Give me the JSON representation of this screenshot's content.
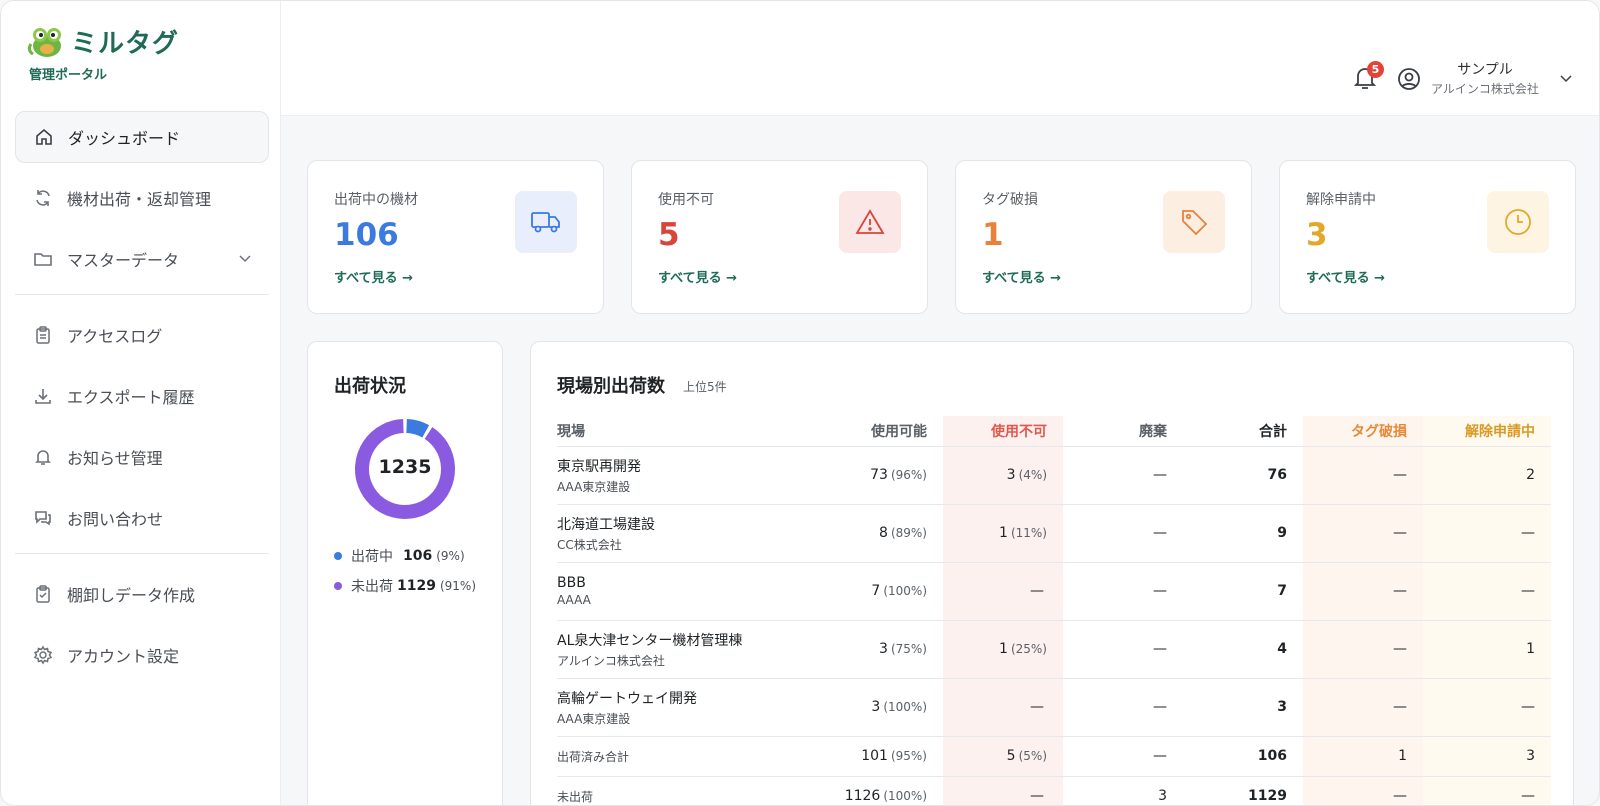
{
  "brand": {
    "name": "ミルタグ",
    "subtitle": "管理ポータル",
    "color": "#1f6b55"
  },
  "sidebar": {
    "items": [
      {
        "label": "ダッシュボード",
        "icon": "home-icon",
        "active": true
      },
      {
        "label": "機材出荷・返却管理",
        "icon": "refresh-icon"
      },
      {
        "label": "マスターデータ",
        "icon": "folder-icon",
        "expandable": true
      },
      {
        "label": "アクセスログ",
        "icon": "clipboard-icon"
      },
      {
        "label": "エクスポート履歴",
        "icon": "download-icon"
      },
      {
        "label": "お知らせ管理",
        "icon": "bell-icon"
      },
      {
        "label": "お問い合わせ",
        "icon": "chat-icon"
      },
      {
        "label": "棚卸しデータ作成",
        "icon": "clipboard-check-icon"
      },
      {
        "label": "アカウント設定",
        "icon": "gear-icon"
      }
    ]
  },
  "header": {
    "notification_count": "5",
    "user_name": "サンプル",
    "user_company": "アルインコ株式会社"
  },
  "stats": [
    {
      "label": "出荷中の機材",
      "value": "106",
      "link": "すべて見る →",
      "color": "#3b7be0",
      "icon": "truck-icon",
      "icon_bg": "#e8eefb"
    },
    {
      "label": "使用不可",
      "value": "5",
      "link": "すべて見る →",
      "color": "#d8453b",
      "icon": "warning-icon",
      "icon_bg": "#fbe7e6"
    },
    {
      "label": "タグ破損",
      "value": "1",
      "link": "すべて見る →",
      "color": "#e8823a",
      "icon": "tag-icon",
      "icon_bg": "#fdeee2"
    },
    {
      "label": "解除申請中",
      "value": "3",
      "link": "すべて見る →",
      "color": "#e3a82a",
      "icon": "clock-icon",
      "icon_bg": "#fdf5e2"
    }
  ],
  "shipping_status": {
    "title": "出荷状況",
    "total": "1235",
    "legend": [
      {
        "label": "出荷中",
        "value": "106",
        "pct": "(9%)",
        "color": "#3b7be0",
        "fraction": 0.086
      },
      {
        "label": "未出荷",
        "value": "1129",
        "pct": "(91%)",
        "color": "#8a5ae0",
        "fraction": 0.914
      }
    ]
  },
  "site_table": {
    "title": "現場別出荷数",
    "subtitle": "上位5件",
    "columns": [
      "現場",
      "使用可能",
      "使用不可",
      "廃棄",
      "合計",
      "タグ破損",
      "解除申請中"
    ],
    "rows": [
      {
        "site": "東京駅再開発",
        "company": "AAA東京建設",
        "usable": "73",
        "usable_pct": "(96%)",
        "unusable": "3",
        "unusable_pct": "(4%)",
        "disposed": "—",
        "total": "76",
        "tag_damage": "—",
        "release": "2"
      },
      {
        "site": "北海道工場建設",
        "company": "CC株式会社",
        "usable": "8",
        "usable_pct": "(89%)",
        "unusable": "1",
        "unusable_pct": "(11%)",
        "disposed": "—",
        "total": "9",
        "tag_damage": "—",
        "release": "—"
      },
      {
        "site": "BBB",
        "company": "AAAA",
        "usable": "7",
        "usable_pct": "(100%)",
        "unusable": "—",
        "unusable_pct": "",
        "disposed": "—",
        "total": "7",
        "tag_damage": "—",
        "release": "—"
      },
      {
        "site": "AL泉大津センター機材管理棟",
        "company": "アルインコ株式会社",
        "usable": "3",
        "usable_pct": "(75%)",
        "unusable": "1",
        "unusable_pct": "(25%)",
        "disposed": "—",
        "total": "4",
        "tag_damage": "—",
        "release": "1"
      },
      {
        "site": "高輪ゲートウェイ開発",
        "company": "AAA東京建設",
        "usable": "3",
        "usable_pct": "(100%)",
        "unusable": "—",
        "unusable_pct": "",
        "disposed": "—",
        "total": "3",
        "tag_damage": "—",
        "release": "—"
      }
    ],
    "summary": [
      {
        "label": "出荷済み合計",
        "usable": "101",
        "usable_pct": "(95%)",
        "unusable": "5",
        "unusable_pct": "(5%)",
        "disposed": "—",
        "total": "106",
        "tag_damage": "1",
        "release": "3"
      },
      {
        "label": "未出荷",
        "usable": "1126",
        "usable_pct": "(100%)",
        "unusable": "—",
        "unusable_pct": "",
        "disposed": "3",
        "total": "1129",
        "tag_damage": "—",
        "release": "—"
      }
    ]
  }
}
